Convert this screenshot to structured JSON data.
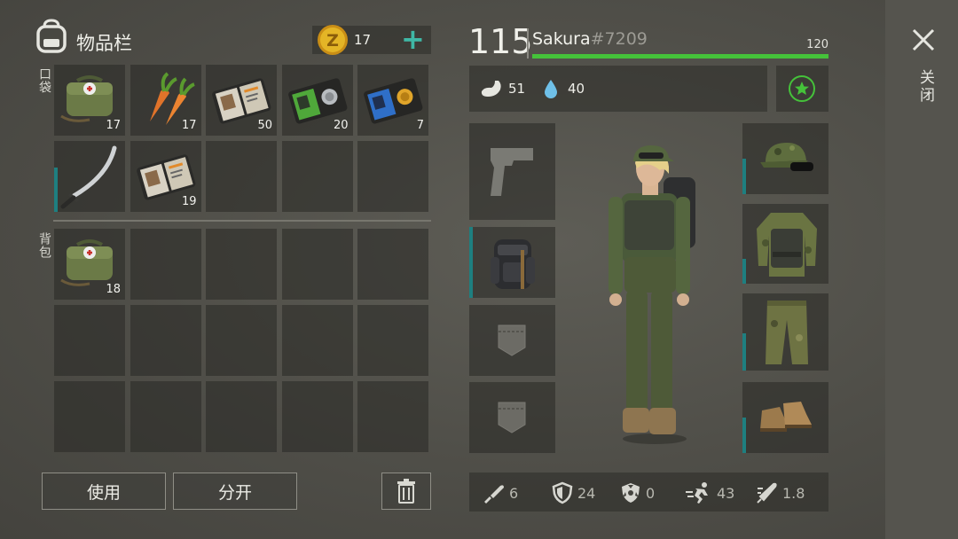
{
  "inventory": {
    "title": "物品栏",
    "coins": "17",
    "add_symbol": "+",
    "pocket_label": "口袋",
    "backpack_label": "背包",
    "pocket_slots": [
      {
        "icon": "medkit-bag-icon",
        "count": "17"
      },
      {
        "icon": "carrot-icon",
        "count": "17"
      },
      {
        "icon": "id-wallet-icon",
        "count": "50"
      },
      {
        "icon": "green-badge-wallet-icon",
        "count": "20"
      },
      {
        "icon": "blue-badge-wallet-icon",
        "count": "7"
      },
      {
        "icon": "katana-icon",
        "count": ""
      },
      {
        "icon": "id-wallet-icon",
        "count": "19"
      }
    ],
    "backpack_slots": [
      {
        "icon": "medkit-bag-icon",
        "count": "18"
      }
    ]
  },
  "actions": {
    "use_label": "使用",
    "split_label": "分开"
  },
  "player": {
    "level": "115",
    "name": "Sakura",
    "tag": "#7209",
    "health_max": "120",
    "health_fraction": 1.0,
    "hunger": "51",
    "thirst": "40"
  },
  "close_label": "关闭",
  "stats": {
    "attack": "6",
    "armor": "24",
    "radiation": "0",
    "speed": "43",
    "weapon_speed": "1.8"
  },
  "colors": {
    "accent_green": "#45c23a",
    "durability_teal": "#1e7f80",
    "coin_gold": "#e4b526"
  }
}
